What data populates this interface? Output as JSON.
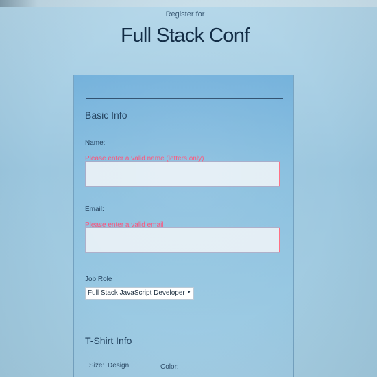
{
  "header": {
    "subtitle": "Register for",
    "title": "Full Stack Conf"
  },
  "basic_info": {
    "heading": "Basic Info",
    "name": {
      "label": "Name:",
      "error": "Please enter a valid name (letters only)",
      "value": ""
    },
    "email": {
      "label": "Email:",
      "error": "Please enter a valid email",
      "value": ""
    },
    "job_role": {
      "label": "Job Role",
      "selected": "Full Stack JavaScript Developer"
    }
  },
  "tshirt_info": {
    "heading": "T-Shirt Info",
    "size_label": "Size:",
    "design_label": "Design:",
    "color_label": "Color:"
  },
  "colors": {
    "error": "#ff4c75",
    "panel": "#89bfdf",
    "heading": "#102a43"
  }
}
